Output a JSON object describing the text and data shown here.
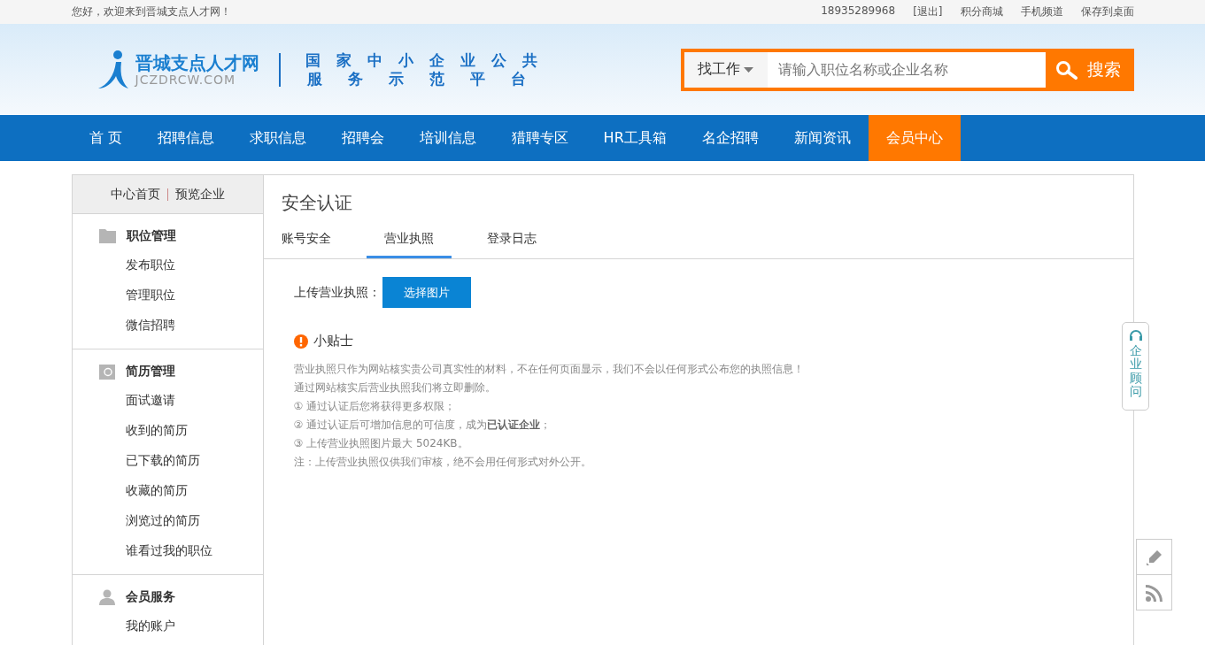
{
  "top_bar": {
    "greeting": "您好，欢迎来到晋城支点人才网！",
    "links": [
      "18935289968",
      "[退出]",
      "积分商城",
      "手机频道",
      "保存到桌面"
    ]
  },
  "header": {
    "logo_name": "晋城支点人才网",
    "logo_domain": "JCZDRCW.COM",
    "slogan_lines": [
      "国家中小企业公共",
      "服务示范平台"
    ],
    "search": {
      "category": "找工作",
      "placeholder": "请输入职位名称或企业名称",
      "button": "搜索"
    }
  },
  "nav": [
    {
      "label": "首 页",
      "selected": false
    },
    {
      "label": "招聘信息",
      "selected": false
    },
    {
      "label": "求职信息",
      "selected": false
    },
    {
      "label": "招聘会",
      "selected": false
    },
    {
      "label": "培训信息",
      "selected": false
    },
    {
      "label": "猎聘专区",
      "selected": false
    },
    {
      "label": "HR工具箱",
      "selected": false
    },
    {
      "label": "名企招聘",
      "selected": false
    },
    {
      "label": "新闻资讯",
      "selected": false
    },
    {
      "label": "会员中心",
      "selected": true
    }
  ],
  "sidebar": {
    "top_links": [
      "中心首页",
      "预览企业"
    ],
    "groups": [
      {
        "kind": "folder",
        "title": "职位管理",
        "items": [
          "发布职位",
          "管理职位",
          "微信招聘"
        ]
      },
      {
        "kind": "resume",
        "title": "简历管理",
        "items": [
          "面试邀请",
          "收到的简历",
          "已下载的简历",
          "收藏的简历",
          "浏览过的简历",
          "谁看过我的职位"
        ]
      },
      {
        "kind": "user",
        "title": "会员服务",
        "items": [
          "我的账户"
        ]
      }
    ]
  },
  "content": {
    "title": "安全认证",
    "tabs": [
      {
        "label": "账号安全",
        "selected": false
      },
      {
        "label": "营业执照",
        "selected": true
      },
      {
        "label": "登录日志",
        "selected": false
      }
    ],
    "upload_label": "上传营业执照：",
    "upload_button": "选择图片",
    "tips_title": "小贴士",
    "tips": [
      "营业执照只作为网站核实贵公司真实性的材料，不在任何页面显示，我们不会以任何形式公布您的执照信息！",
      "通过网站核实后营业执照我们将立即删除。",
      "①  通过认证后您将获得更多权限；",
      "②  通过认证后可增加信息的可信度，成为**已认证企业**；",
      "③  上传营业执照图片最大 5024KB。",
      "注：上传营业执照仅供我们审核，绝不会用任何形式对外公开。"
    ]
  },
  "consultant_tab": "企业顾问"
}
